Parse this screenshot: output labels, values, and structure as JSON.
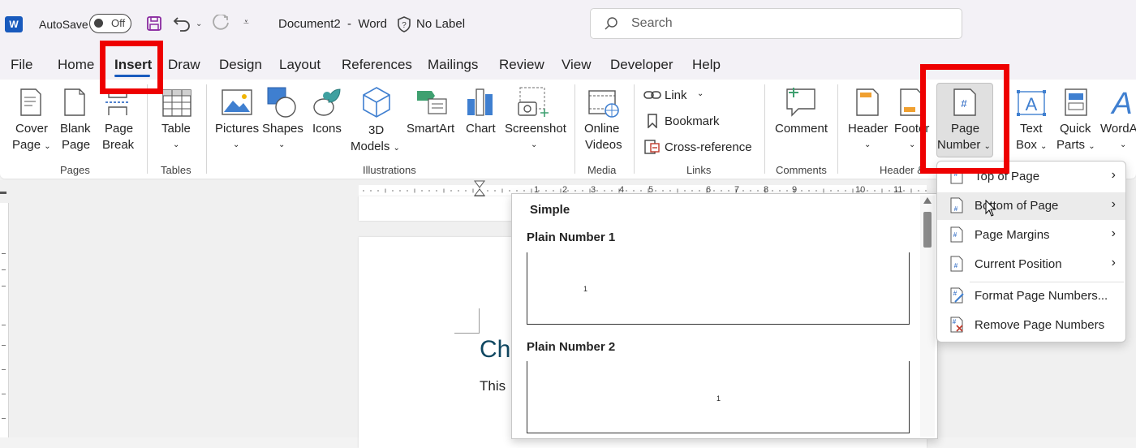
{
  "titlebar": {
    "autosave_label": "AutoSave",
    "toggle_state": "Off",
    "doc_title": "Document2  -  Word",
    "label_text": "No Label",
    "search_placeholder": "Search"
  },
  "tabs": [
    "File",
    "Home",
    "Insert",
    "Draw",
    "Design",
    "Layout",
    "References",
    "Mailings",
    "Review",
    "View",
    "Developer",
    "Help"
  ],
  "active_tab": "Insert",
  "ribbon": {
    "pages": {
      "label": "Pages",
      "cover_1": "Cover",
      "cover_2": "Page",
      "blank_1": "Blank",
      "blank_2": "Page",
      "break_1": "Page",
      "break_2": "Break"
    },
    "tables": {
      "label": "Tables",
      "table": "Table"
    },
    "illustrations": {
      "label": "Illustrations",
      "pictures": "Pictures",
      "shapes": "Shapes",
      "icons": "Icons",
      "models_1": "3D",
      "models_2": "Models",
      "smartart": "SmartArt",
      "chart": "Chart",
      "screenshot": "Screenshot"
    },
    "media": {
      "label": "Media",
      "online_1": "Online",
      "online_2": "Videos"
    },
    "links": {
      "label": "Links",
      "link": "Link",
      "bookmark": "Bookmark",
      "crossref": "Cross-reference"
    },
    "comments": {
      "label": "Comments",
      "comment": "Comment"
    },
    "headerfooter": {
      "label": "Header &",
      "header": "Header",
      "footer": "Footer",
      "pagenum_1": "Page",
      "pagenum_2": "Number"
    },
    "text": {
      "textbox_1": "Text",
      "textbox_2": "Box",
      "quickparts_1": "Quick",
      "quickparts_2": "Parts",
      "wordart": "WordA"
    }
  },
  "ruler_numbers": [
    "1",
    "2",
    "3",
    "4",
    "5",
    "6",
    "7",
    "8",
    "9",
    "10",
    "11"
  ],
  "document": {
    "heading_partial": "Ch",
    "body_partial": "This"
  },
  "gallery": {
    "section": "Simple",
    "item1": "Plain Number 1",
    "item2": "Plain Number 2",
    "preview_number": "1"
  },
  "menu": {
    "items": [
      "Top of Page",
      "Bottom of Page",
      "Page Margins",
      "Current Position",
      "Format Page Numbers...",
      "Remove Page Numbers"
    ]
  },
  "colors": {
    "accent": "#185abd",
    "highlight": "#ee0000",
    "heading": "#0f4761"
  }
}
